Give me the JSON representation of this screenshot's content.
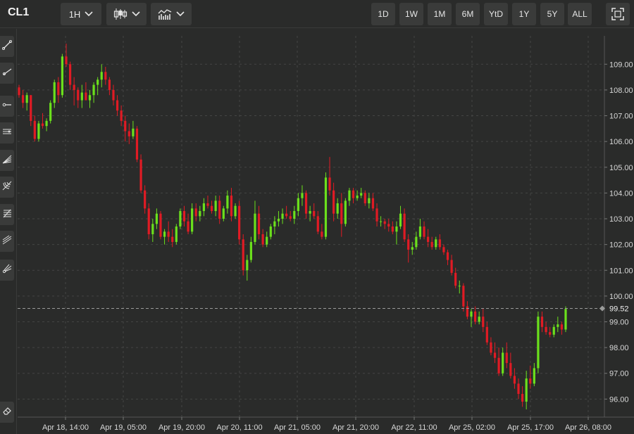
{
  "toolbar": {
    "symbol": "CL1",
    "interval_label": "1H",
    "ranges": [
      "1D",
      "1W",
      "1M",
      "6M",
      "YtD",
      "1Y",
      "5Y",
      "ALL"
    ]
  },
  "colors": {
    "background": "#2a2b2a",
    "up": "#6be01c",
    "down": "#e01b24",
    "grid": "#444544",
    "text": "#d8d8d8"
  },
  "sidebar": {
    "tools": [
      "trend-line-icon",
      "ray-icon",
      "horizontal-line-icon",
      "parallel-channel-icon",
      "fibonacci-fan-icon",
      "gann-fan-icon",
      "fibonacci-retracement-icon",
      "regression-channel-icon",
      "pitchfork-icon"
    ],
    "bottom_tool": "eraser-icon"
  },
  "chart_data": {
    "type": "candlestick",
    "interval": "1H",
    "ylim": [
      95.3,
      110.1
    ],
    "yticks": [
      "109.00",
      "108.00",
      "107.00",
      "106.00",
      "105.00",
      "104.00",
      "103.00",
      "102.00",
      "101.00",
      "100.00",
      "99.00",
      "98.00",
      "97.00",
      "96.00"
    ],
    "xticks": [
      "Apr 18, 14:00",
      "Apr 19, 05:00",
      "Apr 19, 20:00",
      "Apr 20, 11:00",
      "Apr 21, 05:00",
      "Apr 21, 20:00",
      "Apr 22, 11:00",
      "Apr 25, 02:00",
      "Apr 25, 17:00",
      "Apr 26, 08:00"
    ],
    "last_price": "99.52",
    "last_price_value": 99.52,
    "candles": [
      [
        108.1,
        108.2,
        107.7,
        107.8
      ],
      [
        107.8,
        108.0,
        107.3,
        107.5
      ],
      [
        107.5,
        107.9,
        107.2,
        107.8
      ],
      [
        107.8,
        107.8,
        106.6,
        106.8
      ],
      [
        106.8,
        107.0,
        106.0,
        106.1
      ],
      [
        106.1,
        106.8,
        106.0,
        106.7
      ],
      [
        106.7,
        107.1,
        106.5,
        106.6
      ],
      [
        106.6,
        106.9,
        106.4,
        106.8
      ],
      [
        106.8,
        107.6,
        106.7,
        107.5
      ],
      [
        107.5,
        108.4,
        107.3,
        108.3
      ],
      [
        108.3,
        108.5,
        107.5,
        107.8
      ],
      [
        107.8,
        109.4,
        107.7,
        109.3
      ],
      [
        109.3,
        109.8,
        108.9,
        109.0
      ],
      [
        109.0,
        109.1,
        108.0,
        108.2
      ],
      [
        108.2,
        108.5,
        107.4,
        108.0
      ],
      [
        108.0,
        108.1,
        107.3,
        107.6
      ],
      [
        107.6,
        108.2,
        107.3,
        107.9
      ],
      [
        107.9,
        108.3,
        107.6,
        107.6
      ],
      [
        107.6,
        108.0,
        107.3,
        107.8
      ],
      [
        107.8,
        108.3,
        107.5,
        108.2
      ],
      [
        108.2,
        108.5,
        107.8,
        108.4
      ],
      [
        108.4,
        109.0,
        108.1,
        108.7
      ],
      [
        108.7,
        108.9,
        108.2,
        108.4
      ],
      [
        108.4,
        108.5,
        107.8,
        108.0
      ],
      [
        108.0,
        108.2,
        107.4,
        107.6
      ],
      [
        107.6,
        107.8,
        107.0,
        107.2
      ],
      [
        107.2,
        107.4,
        106.6,
        106.8
      ],
      [
        106.8,
        107.0,
        106.0,
        106.4
      ],
      [
        106.4,
        106.7,
        105.9,
        106.2
      ],
      [
        106.2,
        106.8,
        106.1,
        106.5
      ],
      [
        106.5,
        106.6,
        105.2,
        105.3
      ],
      [
        105.3,
        105.5,
        104.0,
        104.1
      ],
      [
        104.1,
        104.3,
        103.2,
        103.4
      ],
      [
        103.4,
        103.6,
        102.2,
        102.4
      ],
      [
        102.4,
        103.0,
        102.1,
        102.8
      ],
      [
        102.8,
        103.4,
        102.6,
        103.2
      ],
      [
        103.2,
        103.3,
        102.2,
        102.3
      ],
      [
        102.3,
        102.6,
        102.0,
        102.5
      ],
      [
        102.5,
        102.9,
        102.1,
        102.3
      ],
      [
        102.3,
        102.6,
        101.9,
        102.1
      ],
      [
        102.1,
        102.8,
        102.0,
        102.7
      ],
      [
        102.7,
        103.4,
        102.6,
        103.3
      ],
      [
        103.3,
        103.5,
        102.7,
        102.9
      ],
      [
        102.9,
        103.2,
        102.4,
        102.5
      ],
      [
        102.5,
        103.6,
        102.4,
        103.4
      ],
      [
        103.4,
        103.6,
        102.9,
        103.1
      ],
      [
        103.1,
        103.5,
        102.9,
        103.3
      ],
      [
        103.3,
        103.8,
        103.1,
        103.6
      ],
      [
        103.6,
        103.9,
        103.4,
        103.5
      ],
      [
        103.5,
        103.7,
        103.2,
        103.3
      ],
      [
        103.3,
        103.9,
        103.1,
        103.7
      ],
      [
        103.7,
        103.9,
        102.8,
        103.0
      ],
      [
        103.0,
        103.5,
        102.9,
        103.4
      ],
      [
        103.4,
        104.1,
        103.2,
        103.9
      ],
      [
        103.9,
        104.2,
        102.9,
        103.1
      ],
      [
        103.1,
        103.6,
        103.0,
        103.5
      ],
      [
        103.5,
        103.7,
        102.0,
        102.2
      ],
      [
        102.2,
        102.4,
        100.8,
        101.0
      ],
      [
        101.0,
        101.6,
        100.6,
        101.4
      ],
      [
        101.4,
        102.3,
        101.3,
        102.1
      ],
      [
        102.1,
        103.7,
        102.0,
        103.2
      ],
      [
        103.2,
        103.5,
        102.2,
        102.4
      ],
      [
        102.4,
        102.6,
        101.9,
        102.0
      ],
      [
        102.0,
        102.5,
        101.9,
        102.3
      ],
      [
        102.3,
        102.8,
        102.2,
        102.7
      ],
      [
        102.7,
        103.1,
        102.4,
        102.9
      ],
      [
        102.9,
        103.3,
        102.7,
        103.0
      ],
      [
        103.0,
        103.4,
        102.8,
        103.2
      ],
      [
        103.2,
        103.5,
        103.0,
        103.1
      ],
      [
        103.1,
        103.3,
        102.9,
        103.0
      ],
      [
        103.0,
        103.5,
        102.8,
        103.3
      ],
      [
        103.3,
        104.0,
        103.1,
        103.8
      ],
      [
        103.8,
        104.3,
        103.5,
        104.0
      ],
      [
        104.0,
        104.1,
        103.0,
        103.2
      ],
      [
        103.2,
        103.5,
        102.9,
        103.3
      ],
      [
        103.3,
        103.6,
        103.0,
        103.1
      ],
      [
        103.1,
        103.3,
        102.4,
        102.5
      ],
      [
        102.5,
        102.8,
        102.2,
        102.3
      ],
      [
        102.3,
        104.8,
        102.2,
        104.6
      ],
      [
        104.6,
        105.4,
        103.9,
        104.1
      ],
      [
        104.1,
        104.4,
        102.9,
        103.2
      ],
      [
        103.2,
        103.8,
        103.0,
        103.6
      ],
      [
        103.6,
        104.0,
        102.3,
        102.8
      ],
      [
        102.8,
        103.8,
        102.7,
        103.7
      ],
      [
        103.7,
        104.2,
        103.5,
        104.1
      ],
      [
        104.1,
        104.2,
        103.6,
        103.8
      ],
      [
        103.8,
        104.1,
        103.7,
        103.9
      ],
      [
        103.9,
        104.2,
        103.8,
        104.0
      ],
      [
        104.0,
        104.1,
        103.5,
        103.6
      ],
      [
        103.6,
        104.0,
        103.4,
        103.8
      ],
      [
        103.8,
        104.0,
        103.3,
        103.4
      ],
      [
        103.4,
        103.6,
        102.7,
        102.9
      ],
      [
        102.9,
        103.1,
        102.7,
        102.9
      ],
      [
        102.9,
        103.0,
        102.6,
        102.8
      ],
      [
        102.8,
        103.0,
        102.5,
        102.7
      ],
      [
        102.7,
        102.9,
        102.4,
        102.5
      ],
      [
        102.5,
        102.9,
        102.0,
        102.7
      ],
      [
        102.7,
        103.5,
        102.6,
        103.2
      ],
      [
        103.2,
        103.4,
        102.1,
        102.2
      ],
      [
        102.2,
        102.4,
        101.3,
        101.8
      ],
      [
        101.8,
        102.1,
        101.6,
        101.9
      ],
      [
        101.9,
        102.5,
        101.8,
        102.3
      ],
      [
        102.3,
        103.0,
        102.2,
        102.7
      ],
      [
        102.7,
        102.9,
        102.2,
        102.3
      ],
      [
        102.3,
        102.6,
        101.9,
        102.1
      ],
      [
        102.1,
        102.3,
        101.8,
        101.9
      ],
      [
        101.9,
        102.3,
        101.8,
        102.2
      ],
      [
        102.2,
        102.4,
        101.8,
        101.9
      ],
      [
        101.9,
        102.0,
        101.6,
        101.7
      ],
      [
        101.7,
        101.8,
        101.2,
        101.4
      ],
      [
        101.4,
        101.6,
        100.8,
        100.9
      ],
      [
        100.9,
        101.1,
        100.3,
        100.4
      ],
      [
        100.4,
        100.6,
        100.1,
        100.4
      ],
      [
        100.4,
        100.5,
        99.4,
        99.6
      ],
      [
        99.6,
        99.8,
        99.1,
        99.2
      ],
      [
        99.2,
        99.5,
        98.8,
        99.4
      ],
      [
        99.4,
        99.6,
        98.9,
        99.0
      ],
      [
        99.0,
        99.4,
        98.9,
        99.2
      ],
      [
        99.2,
        99.5,
        98.6,
        98.8
      ],
      [
        98.8,
        99.0,
        98.1,
        98.2
      ],
      [
        98.2,
        98.4,
        97.7,
        97.8
      ],
      [
        97.8,
        98.2,
        97.4,
        97.6
      ],
      [
        97.6,
        98.0,
        96.9,
        97.0
      ],
      [
        97.0,
        98.0,
        96.9,
        97.8
      ],
      [
        97.8,
        98.2,
        97.2,
        97.4
      ],
      [
        97.4,
        97.8,
        96.8,
        96.9
      ],
      [
        96.9,
        97.2,
        96.4,
        96.6
      ],
      [
        96.6,
        96.8,
        96.0,
        96.2
      ],
      [
        96.2,
        96.5,
        95.7,
        95.9
      ],
      [
        95.9,
        97.1,
        95.6,
        96.8
      ],
      [
        96.8,
        97.3,
        96.4,
        96.6
      ],
      [
        96.6,
        97.4,
        96.5,
        97.2
      ],
      [
        97.2,
        99.4,
        97.0,
        99.2
      ],
      [
        99.2,
        99.4,
        98.6,
        98.8
      ],
      [
        98.8,
        99.0,
        98.5,
        98.6
      ],
      [
        98.6,
        98.8,
        98.4,
        98.5
      ],
      [
        98.5,
        98.9,
        98.4,
        98.8
      ],
      [
        98.8,
        99.2,
        98.6,
        98.9
      ],
      [
        98.9,
        99.0,
        98.5,
        98.7
      ],
      [
        98.7,
        99.6,
        98.6,
        99.5
      ]
    ]
  }
}
